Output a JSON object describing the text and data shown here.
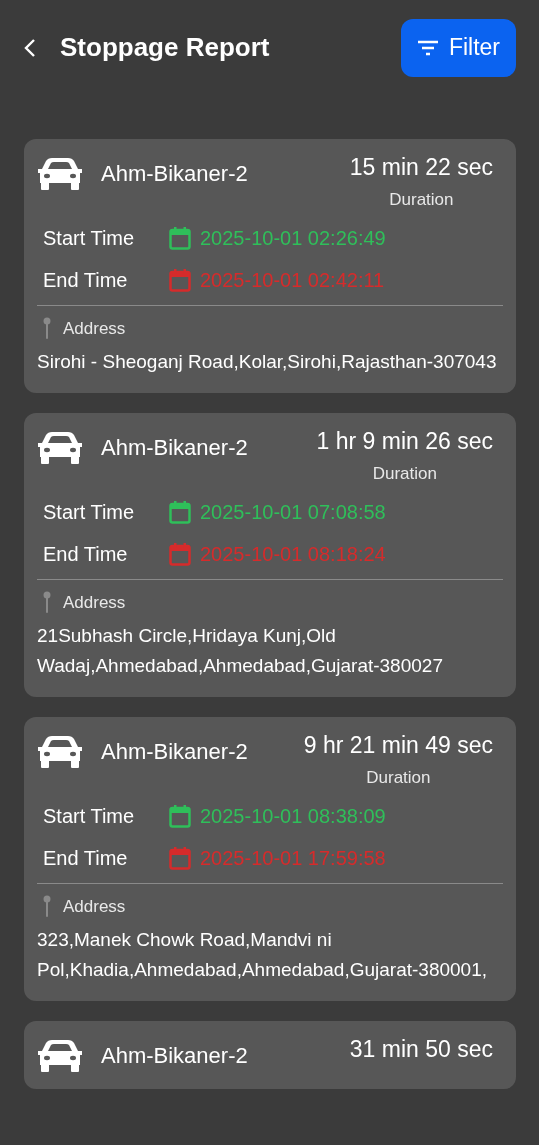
{
  "header": {
    "title": "Stoppage Report",
    "filter_button": "Filter"
  },
  "stops": [
    {
      "vehicle": "Ahm-Bikaner-2",
      "duration": "15 min 22 sec",
      "duration_label": "Duration",
      "start_label": "Start Time",
      "start_time": "2025-10-01 02:26:49",
      "end_label": "End Time",
      "end_time": "2025-10-01 02:42:11",
      "address_label": "Address",
      "address": "Sirohi - Sheoganj Road,Kolar,Sirohi,Rajasthan-307043"
    },
    {
      "vehicle": "Ahm-Bikaner-2",
      "duration": "1 hr 9 min 26 sec",
      "duration_label": "Duration",
      "start_label": "Start Time",
      "start_time": "2025-10-01 07:08:58",
      "end_label": "End Time",
      "end_time": "2025-10-01 08:18:24",
      "address_label": "Address",
      "address": "21Subhash Circle,Hridaya Kunj,Old Wadaj,Ahmedabad,Ahmedabad,Gujarat-380027"
    },
    {
      "vehicle": "Ahm-Bikaner-2",
      "duration": "9 hr 21 min 49 sec",
      "duration_label": "Duration",
      "start_label": "Start Time",
      "start_time": "2025-10-01 08:38:09",
      "end_label": "End Time",
      "end_time": "2025-10-01 17:59:58",
      "address_label": "Address",
      "address": "323,Manek Chowk Road,Mandvi ni Pol,Khadia,Ahmedabad,Ahmedabad,Gujarat-380001,"
    },
    {
      "vehicle": "Ahm-Bikaner-2",
      "duration": "31 min 50 sec"
    }
  ]
}
